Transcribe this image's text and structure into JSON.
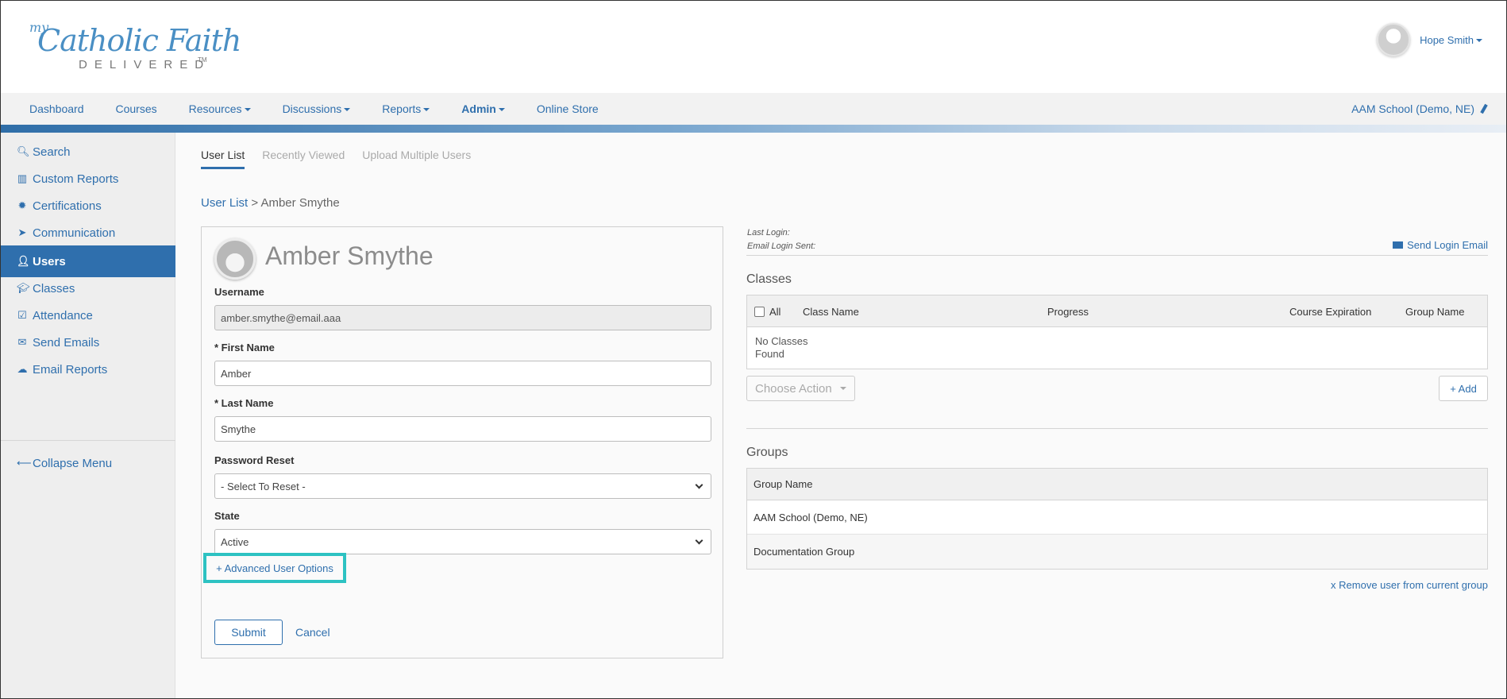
{
  "header": {
    "logo": {
      "my": "my",
      "catholic_faith": "Catholic Faith",
      "delivered": "DELIVERED",
      "tm": "TM"
    },
    "user_name": "Hope Smith"
  },
  "nav": {
    "items": [
      {
        "label": "Dashboard",
        "has_caret": false,
        "bold": false
      },
      {
        "label": "Courses",
        "has_caret": false,
        "bold": false
      },
      {
        "label": "Resources",
        "has_caret": true,
        "bold": false
      },
      {
        "label": "Discussions",
        "has_caret": true,
        "bold": false
      },
      {
        "label": "Reports",
        "has_caret": true,
        "bold": false
      },
      {
        "label": "Admin",
        "has_caret": true,
        "bold": true
      },
      {
        "label": "Online Store",
        "has_caret": false,
        "bold": false
      }
    ],
    "school": "AAM School (Demo, NE)"
  },
  "sidebar": {
    "items": [
      {
        "label": "Search",
        "icon": "search-icon"
      },
      {
        "label": "Custom Reports",
        "icon": "bar-chart-icon"
      },
      {
        "label": "Certifications",
        "icon": "certificate-icon"
      },
      {
        "label": "Communication",
        "icon": "paper-plane-icon"
      },
      {
        "label": "Users",
        "icon": "user-icon"
      },
      {
        "label": "Classes",
        "icon": "graduation-cap-icon"
      },
      {
        "label": "Attendance",
        "icon": "check-square-icon"
      },
      {
        "label": "Send Emails",
        "icon": "envelope-icon"
      },
      {
        "label": "Email Reports",
        "icon": "cloud-upload-icon"
      }
    ],
    "active_index": 4,
    "collapse_label": "Collapse Menu"
  },
  "tabs": [
    {
      "label": "User List",
      "active": true
    },
    {
      "label": "Recently Viewed",
      "active": false
    },
    {
      "label": "Upload Multiple Users",
      "active": false
    }
  ],
  "breadcrumb": {
    "link": "User List",
    "separator": ">",
    "current": "Amber Smythe"
  },
  "form": {
    "title": "Amber Smythe",
    "username_label": "Username",
    "username_value": "amber.smythe@email.aaa",
    "first_name_label": "* First Name",
    "first_name_value": "Amber",
    "last_name_label": "* Last Name",
    "last_name_value": "Smythe",
    "password_reset_label": "Password Reset",
    "password_reset_value": "- Select To Reset -",
    "state_label": "State",
    "state_value": "Active",
    "advanced_label": "+ Advanced User Options",
    "submit_label": "Submit",
    "cancel_label": "Cancel"
  },
  "details": {
    "last_login_label": "Last Login:",
    "email_login_sent_label": "Email Login Sent:",
    "send_login_email_label": "Send Login Email"
  },
  "classes": {
    "title": "Classes",
    "columns": {
      "all": "All",
      "class_name": "Class Name",
      "progress": "Progress",
      "course_expiration": "Course Expiration",
      "group_name": "Group Name"
    },
    "empty_text": "No Classes Found",
    "choose_action_label": "Choose Action",
    "add_label": "+ Add"
  },
  "groups": {
    "title": "Groups",
    "column": "Group Name",
    "rows": [
      "AAM School (Demo, NE)",
      "Documentation Group"
    ],
    "remove_label": "x Remove user from current group"
  },
  "colors": {
    "accent": "#2f6fad",
    "highlight": "#2dc2c2"
  }
}
